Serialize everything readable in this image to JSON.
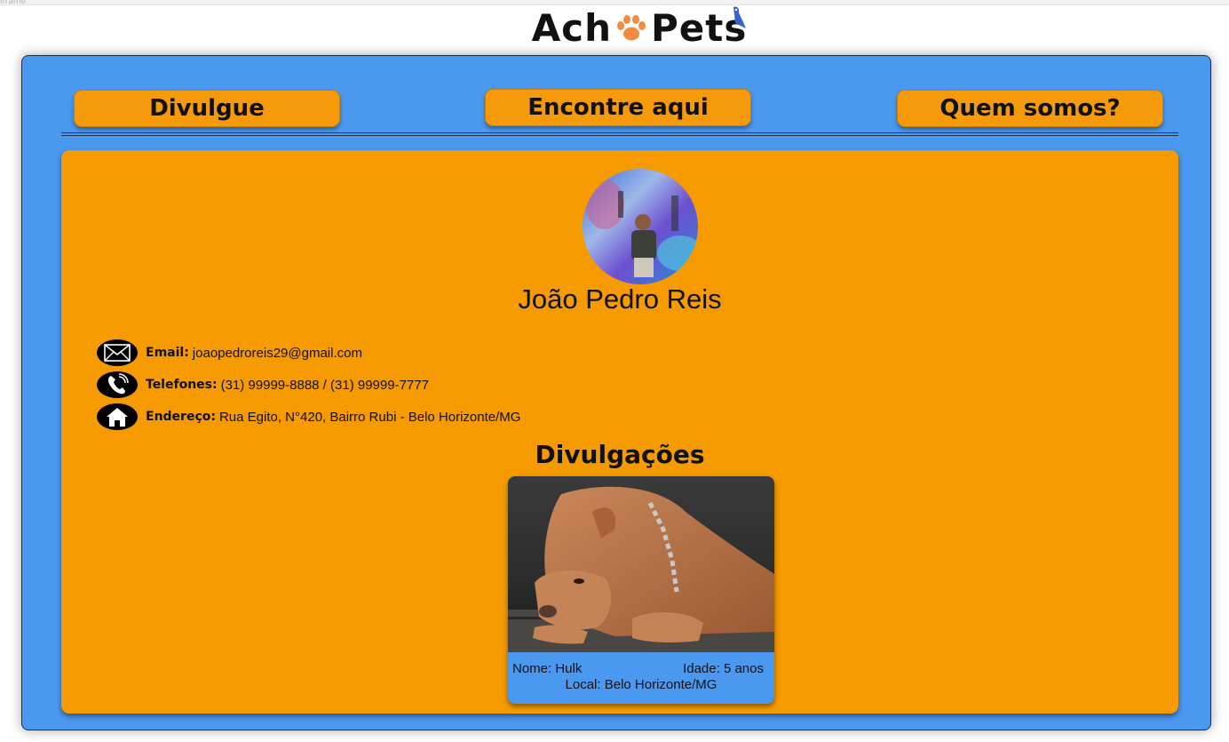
{
  "window": {
    "frame_label": "iframe"
  },
  "brand": {
    "name_left": "Ach",
    "name_right": "Pets"
  },
  "nav": [
    {
      "label": "Divulgue"
    },
    {
      "label": "Encontre aqui"
    },
    {
      "label": "Quem somos?"
    }
  ],
  "profile": {
    "name": "João Pedro Reis",
    "contacts": [
      {
        "icon": "envelope-icon",
        "label": "Email:",
        "value": "joaopedroreis29@gmail.com"
      },
      {
        "icon": "phone-icon",
        "label": "Telefones:",
        "value": "(31) 99999-8888 / (31) 99999-7777"
      },
      {
        "icon": "home-icon",
        "label": "Endereço:",
        "value": "Rua Egito, N°420, Bairro Rubi - Belo Horizonte/MG"
      }
    ]
  },
  "posts": {
    "title": "Divulgações",
    "items": [
      {
        "name": "Nome: Hulk",
        "age": "Idade: 5 anos",
        "local": "Local: Belo Horizonte/MG"
      }
    ]
  },
  "colors": {
    "frame_blue": "#4a98f0",
    "orange": "#f59a00",
    "text": "#111111"
  }
}
